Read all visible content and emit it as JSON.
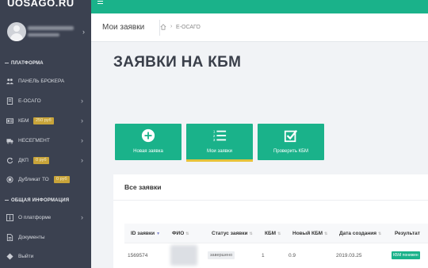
{
  "app": {
    "logo": "UOSAGO.RU"
  },
  "sidebar": {
    "section_platform": "ПЛАТФОРМА",
    "section_info": "ОБЩАЯ ИНФОРМАЦИЯ",
    "items": [
      {
        "label": "ПАНЕЛЬ БРОКЕРА",
        "icon": "users-icon"
      },
      {
        "label": "Е-ОСАГО",
        "icon": "document-icon"
      },
      {
        "label": "КБМ",
        "icon": "id-card-icon",
        "badge": "250 руб"
      },
      {
        "label": "НЕСЕГМЕНТ",
        "icon": "truck-icon"
      },
      {
        "label": "ДКП",
        "icon": "refresh-icon",
        "badge": "0 руб"
      },
      {
        "label": "Дубликат ТО",
        "icon": "copy-icon",
        "badge": "0 руб"
      },
      {
        "label": "О платформе",
        "icon": "info-icon"
      },
      {
        "label": "Документы",
        "icon": "file-icon"
      },
      {
        "label": "Выйти",
        "icon": "logout-icon"
      }
    ]
  },
  "header": {
    "page_title": "Мои заявки",
    "breadcrumb": "Е-ОСАГО"
  },
  "main": {
    "heading": "ЗАЯВКИ НА КБМ",
    "tiles": [
      {
        "label": "Новая заявка",
        "icon": "plus-circle-icon"
      },
      {
        "label": "Мои заявки",
        "icon": "numbered-list-icon"
      },
      {
        "label": "Проверить КБМ",
        "icon": "checkbox-icon"
      }
    ],
    "card_title": "Все заявки",
    "table": {
      "columns": [
        "ID заявки",
        "ФИО",
        "Статус заявки",
        "КБМ",
        "Новый КБМ",
        "Дата создания",
        "Результат"
      ],
      "rows": [
        {
          "id": "1569574",
          "status": "завершено",
          "kbm": "1",
          "new_kbm": "0.9",
          "date": "2019.03.25",
          "result": "КБМ понижен"
        }
      ]
    }
  },
  "colors": {
    "accent": "#1ab28a",
    "sidebar": "#3b4150",
    "badge": "#c8a43a",
    "active_bar": "#e6c33a"
  }
}
